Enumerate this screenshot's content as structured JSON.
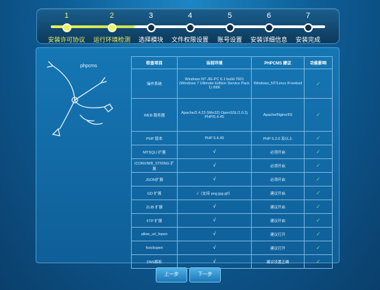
{
  "steps": [
    {
      "num": "1",
      "label": "安装许可协议",
      "done": true
    },
    {
      "num": "2",
      "label": "运行环境检测",
      "done": true
    },
    {
      "num": "3",
      "label": "选择模块",
      "done": false
    },
    {
      "num": "4",
      "label": "文件权限设置",
      "done": false
    },
    {
      "num": "5",
      "label": "账号设置",
      "done": false
    },
    {
      "num": "6",
      "label": "安装详细信息",
      "done": false
    },
    {
      "num": "7",
      "label": "安装完成",
      "done": false
    }
  ],
  "illustration_label": "phpcms",
  "table": {
    "headers": [
      "检查项目",
      "当前环境",
      "PHPCMS 建议",
      "功能影响"
    ],
    "rows": [
      {
        "item": "操作系统",
        "current": "Windows NT JIE-PC 6.1 build 7601 (Windows 7 Ultimate Edition Service Pack 1) i586",
        "suggest": "Windows_NT/Linux /Freebsd",
        "impact": "✓"
      },
      {
        "item": "WEB 服务器",
        "current": "Apache/2.4.23 (Win32) OpenSSL/1.0.2j PHP/5.4.45",
        "suggest": "Apache/Nginx/IIS",
        "impact": "✓"
      },
      {
        "item": "PHP 版本",
        "current": "PHP 5.4.45",
        "suggest": "PHP 5.2.0 及以上",
        "impact": "✓"
      },
      {
        "item": "MYSQLI 扩展",
        "current": "√",
        "suggest": "必须开启",
        "impact": "✓"
      },
      {
        "item": "ICONV/MB_STRING 扩展",
        "current": "√",
        "suggest": "必须开启",
        "impact": "✓"
      },
      {
        "item": "JSON扩展",
        "current": "√",
        "suggest": "必须开启",
        "impact": "✓"
      },
      {
        "item": "GD 扩展",
        "current": "√（支持 png jpg gif）",
        "suggest": "建议开启",
        "impact": "✓"
      },
      {
        "item": "ZLIB 扩展",
        "current": "√",
        "suggest": "建议开启",
        "impact": "✓"
      },
      {
        "item": "FTP 扩展",
        "current": "√",
        "suggest": "建议开启",
        "impact": "✓"
      },
      {
        "item": "allow_url_fopen",
        "current": "√",
        "suggest": "建议打开",
        "impact": "✓"
      },
      {
        "item": "fsockopen",
        "current": "√",
        "suggest": "建议打开",
        "impact": "✓"
      },
      {
        "item": "DNS解析",
        "current": "√",
        "suggest": "建议设置正确",
        "impact": "✓"
      }
    ]
  },
  "buttons": {
    "prev": "上一步",
    "next": "下一步"
  },
  "colors": {
    "done": "#e9f36a",
    "check": "#6fe05b",
    "panel": "#1576b4"
  }
}
